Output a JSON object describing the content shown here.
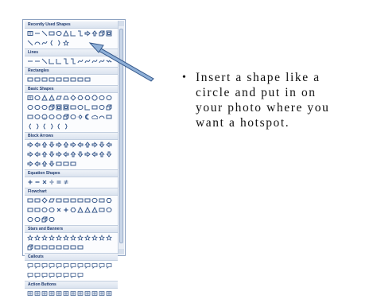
{
  "gallery": {
    "sections": [
      {
        "title": "Recently Used Shapes",
        "rows": [
          [
            "textbox",
            "line",
            "line-diagonal",
            "rect",
            "ellipse",
            "triangle",
            "l-connector",
            "elbow-connector",
            "arrow-right",
            "arrow-up",
            "cube",
            "frame"
          ],
          [
            "line-diagonal",
            "arc",
            "curve",
            "left-brace",
            "right-brace",
            "star"
          ]
        ]
      },
      {
        "title": "Lines",
        "rows": [
          [
            "line",
            "line",
            "line-diagonal",
            "l-connector",
            "l-connector",
            "elbow-connector",
            "elbow-connector",
            "curve",
            "curve",
            "curve",
            "curve",
            "squiggle"
          ]
        ]
      },
      {
        "title": "Rectangles",
        "rows": [
          [
            "rect",
            "rect",
            "rect",
            "rect",
            "rect",
            "rect",
            "rect",
            "rect",
            "rect"
          ]
        ]
      },
      {
        "title": "Basic Shapes",
        "rows": [
          [
            "textbox",
            "ellipse",
            "triangle",
            "triangle",
            "parallelogram",
            "trapezoid",
            "diamond",
            "hexagon",
            "hexagon",
            "octagon",
            "ellipse",
            "ellipse"
          ],
          [
            "ellipse",
            "ellipse",
            "ellipse",
            "cube",
            "frame",
            "frame",
            "rect",
            "ellipse",
            "l-connector",
            "rect",
            "ellipse",
            "cube"
          ],
          [
            "rect",
            "ellipse",
            "smiley",
            "ellipse",
            "ellipse",
            "cube",
            "ellipse",
            "sun",
            "moon",
            "cloud",
            "arc",
            "rect"
          ],
          [
            "left-brace",
            "right-brace",
            "left-brace",
            "right-brace",
            "left-brace",
            "right-brace"
          ]
        ]
      },
      {
        "title": "Block Arrows",
        "rows": [
          [
            "arrow-right",
            "arrow-left",
            "arrow-up",
            "arrow-down",
            "arrow-right",
            "arrow-up",
            "arrow-right",
            "arrow-left",
            "arrow-up",
            "arrow-right",
            "arrow-down",
            "arrow-left"
          ],
          [
            "arrow-right",
            "arrow-left",
            "arrow-up",
            "arrow-down",
            "arrow-right",
            "arrow-left",
            "arrow-up",
            "arrow-down",
            "arrow-right",
            "arrow-left",
            "arrow-up",
            "arrow-down"
          ],
          [
            "arrow-right",
            "arrow-left",
            "arrow-up",
            "arrow-down",
            "rect",
            "rect",
            "rect"
          ]
        ]
      },
      {
        "title": "Equation Shapes",
        "rows": [
          [
            "plus",
            "minus",
            "times",
            "divide",
            "equals",
            "not-equal"
          ]
        ]
      },
      {
        "title": "Flowchart",
        "rows": [
          [
            "rect",
            "rect",
            "diamond",
            "parallelogram",
            "rect",
            "rect",
            "rect",
            "rect",
            "rect",
            "ellipse",
            "rect",
            "hexagon"
          ],
          [
            "rect",
            "rect",
            "ellipse",
            "ellipse",
            "times",
            "plus",
            "hexagon",
            "triangle",
            "triangle",
            "triangle",
            "rect",
            "ellipse"
          ],
          [
            "ellipse",
            "ellipse",
            "cube",
            "ellipse"
          ]
        ]
      },
      {
        "title": "Stars and Banners",
        "rows": [
          [
            "star",
            "star",
            "star",
            "star",
            "star",
            "star",
            "star",
            "star",
            "star",
            "star",
            "star",
            "star"
          ],
          [
            "cube",
            "rect",
            "rect",
            "rect",
            "rect",
            "rect",
            "rect",
            "rect"
          ]
        ]
      },
      {
        "title": "Callouts",
        "rows": [
          [
            "callout",
            "callout",
            "callout",
            "callout",
            "callout",
            "callout",
            "callout",
            "callout",
            "callout",
            "callout",
            "callout",
            "callout"
          ],
          [
            "callout",
            "callout",
            "callout",
            "callout",
            "callout",
            "callout",
            "callout",
            "callout"
          ]
        ]
      },
      {
        "title": "Action Buttons",
        "rows": [
          [
            "action",
            "action",
            "action",
            "action",
            "action",
            "action",
            "action",
            "action",
            "action",
            "action",
            "action",
            "action"
          ]
        ]
      }
    ]
  },
  "slide": {
    "bullet_symbol": "•",
    "lines": [
      "Insert a shape like a",
      "circle and put in on",
      "your photo where you",
      "want a hotspot."
    ]
  },
  "colors": {
    "shape_stroke": "#3a5a8c",
    "pointer_fill": "#8fb0d8",
    "pointer_stroke": "#35588a"
  }
}
